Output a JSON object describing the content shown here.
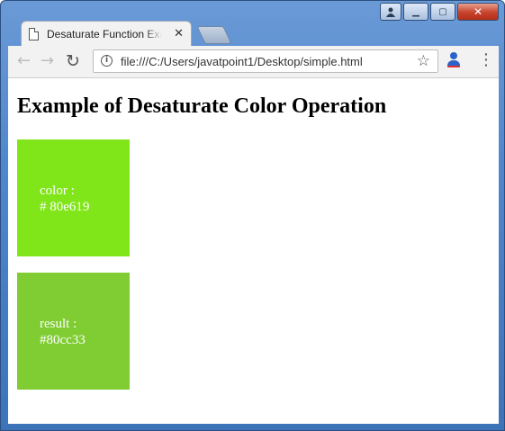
{
  "browser": {
    "tab_title": "Desaturate Function Exam",
    "tab_close_glyph": "✕",
    "url": "file:///C:/Users/javatpoint1/Desktop/simple.html",
    "icons": {
      "back": "back-arrow-icon",
      "forward": "forward-arrow-icon",
      "reload": "reload-icon",
      "info": "info-icon",
      "bookmark": "star-icon",
      "extension": "user-extension-icon",
      "menu": "kebab-menu-icon"
    },
    "window_buttons": {
      "minimize": "▁",
      "maximize": "▢",
      "close": "✕",
      "user": "👤"
    }
  },
  "page": {
    "heading": "Example of Desaturate Color Operation",
    "boxes": [
      {
        "label": "color :",
        "value": "# 80e619",
        "background": "#80e619"
      },
      {
        "label": "result :",
        "value": "#80cc33",
        "background": "#80cc33"
      }
    ]
  }
}
